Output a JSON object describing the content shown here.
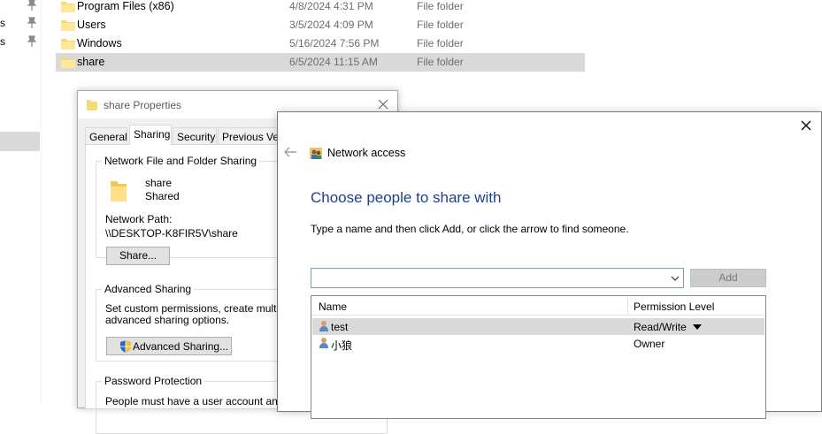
{
  "explorer": {
    "nav_fragments": [
      "",
      "s",
      "s"
    ],
    "files": [
      {
        "name": "Program Files (x86)",
        "date": "4/8/2024 4:31 PM",
        "type": "File folder",
        "selected": false
      },
      {
        "name": "Users",
        "date": "3/5/2024 4:09 PM",
        "type": "File folder",
        "selected": false
      },
      {
        "name": "Windows",
        "date": "5/16/2024 7:56 PM",
        "type": "File folder",
        "selected": false
      },
      {
        "name": "share",
        "date": "6/5/2024 11:15 AM",
        "type": "File folder",
        "selected": true
      }
    ]
  },
  "properties": {
    "title": "share Properties",
    "tabs": [
      "General",
      "Sharing",
      "Security",
      "Previous Vers"
    ],
    "active_tab": "Sharing",
    "network_sharing": {
      "legend": "Network File and Folder Sharing",
      "folder_name": "share",
      "status": "Shared",
      "path_label": "Network Path:",
      "path_value": "\\\\DESKTOP-K8FIR5V\\share",
      "share_button": "Share..."
    },
    "advanced": {
      "legend": "Advanced Sharing",
      "text_line1": "Set custom permissions, create multiple sh",
      "text_line2": "advanced sharing options.",
      "button": "Advanced Sharing..."
    },
    "password": {
      "legend": "Password Protection",
      "text_line1": "People must have a user account and pa"
    }
  },
  "wizard": {
    "title": "Network access",
    "heading": "Choose people to share with",
    "instruction": "Type a name and then click Add, or click the arrow to find someone.",
    "input_value": "",
    "add_button": "Add",
    "columns": {
      "name": "Name",
      "permission": "Permission Level"
    },
    "users": [
      {
        "name": "test",
        "permission": "Read/Write",
        "selected": true
      },
      {
        "name": "小狼",
        "permission": "Owner",
        "selected": false
      }
    ]
  },
  "colors": {
    "heading_blue": "#1f3f8f",
    "selection_gray": "#d9d9d9",
    "folder_yellow": "#f8d775"
  }
}
